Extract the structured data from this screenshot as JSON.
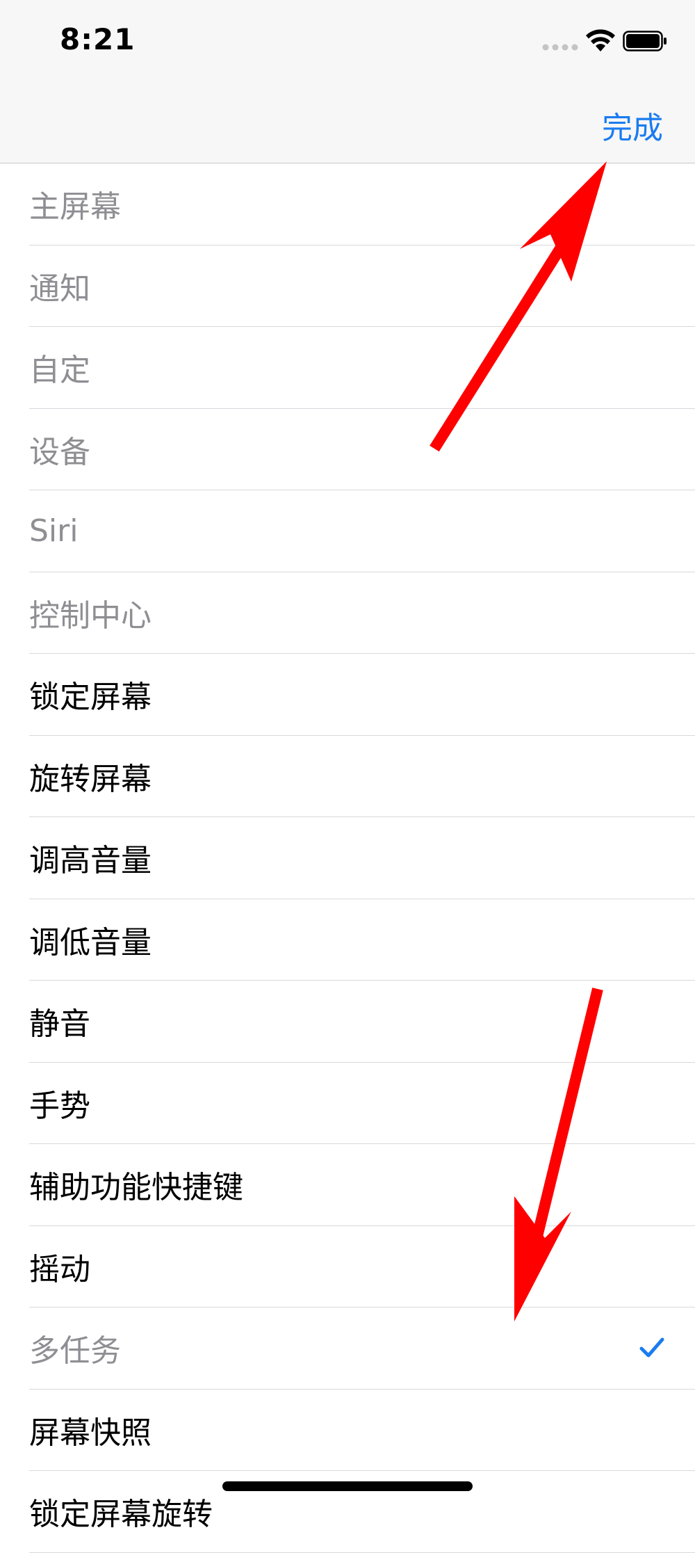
{
  "status_bar": {
    "time": "8:21",
    "icons": [
      "signal-dots-icon",
      "wifi-icon",
      "battery-icon"
    ]
  },
  "nav_bar": {
    "done_label": "完成",
    "accent_color": "#1a7cf0"
  },
  "list": {
    "items": [
      {
        "label": "主屏幕",
        "enabled": false,
        "checked": false
      },
      {
        "label": "通知",
        "enabled": false,
        "checked": false
      },
      {
        "label": "自定",
        "enabled": false,
        "checked": false
      },
      {
        "label": "设备",
        "enabled": false,
        "checked": false
      },
      {
        "label": "Siri",
        "enabled": false,
        "checked": false
      },
      {
        "label": "控制中心",
        "enabled": false,
        "checked": false
      },
      {
        "label": "锁定屏幕",
        "enabled": true,
        "checked": false
      },
      {
        "label": "旋转屏幕",
        "enabled": true,
        "checked": false
      },
      {
        "label": "调高音量",
        "enabled": true,
        "checked": false
      },
      {
        "label": "调低音量",
        "enabled": true,
        "checked": false
      },
      {
        "label": "静音",
        "enabled": true,
        "checked": false
      },
      {
        "label": "手势",
        "enabled": true,
        "checked": false
      },
      {
        "label": "辅助功能快捷键",
        "enabled": true,
        "checked": false
      },
      {
        "label": "摇动",
        "enabled": true,
        "checked": false
      },
      {
        "label": "多任务",
        "enabled": false,
        "checked": true
      },
      {
        "label": "屏幕快照",
        "enabled": true,
        "checked": false
      },
      {
        "label": "锁定屏幕旋转",
        "enabled": true,
        "checked": false
      }
    ]
  },
  "annotation_color": "#ff0000"
}
